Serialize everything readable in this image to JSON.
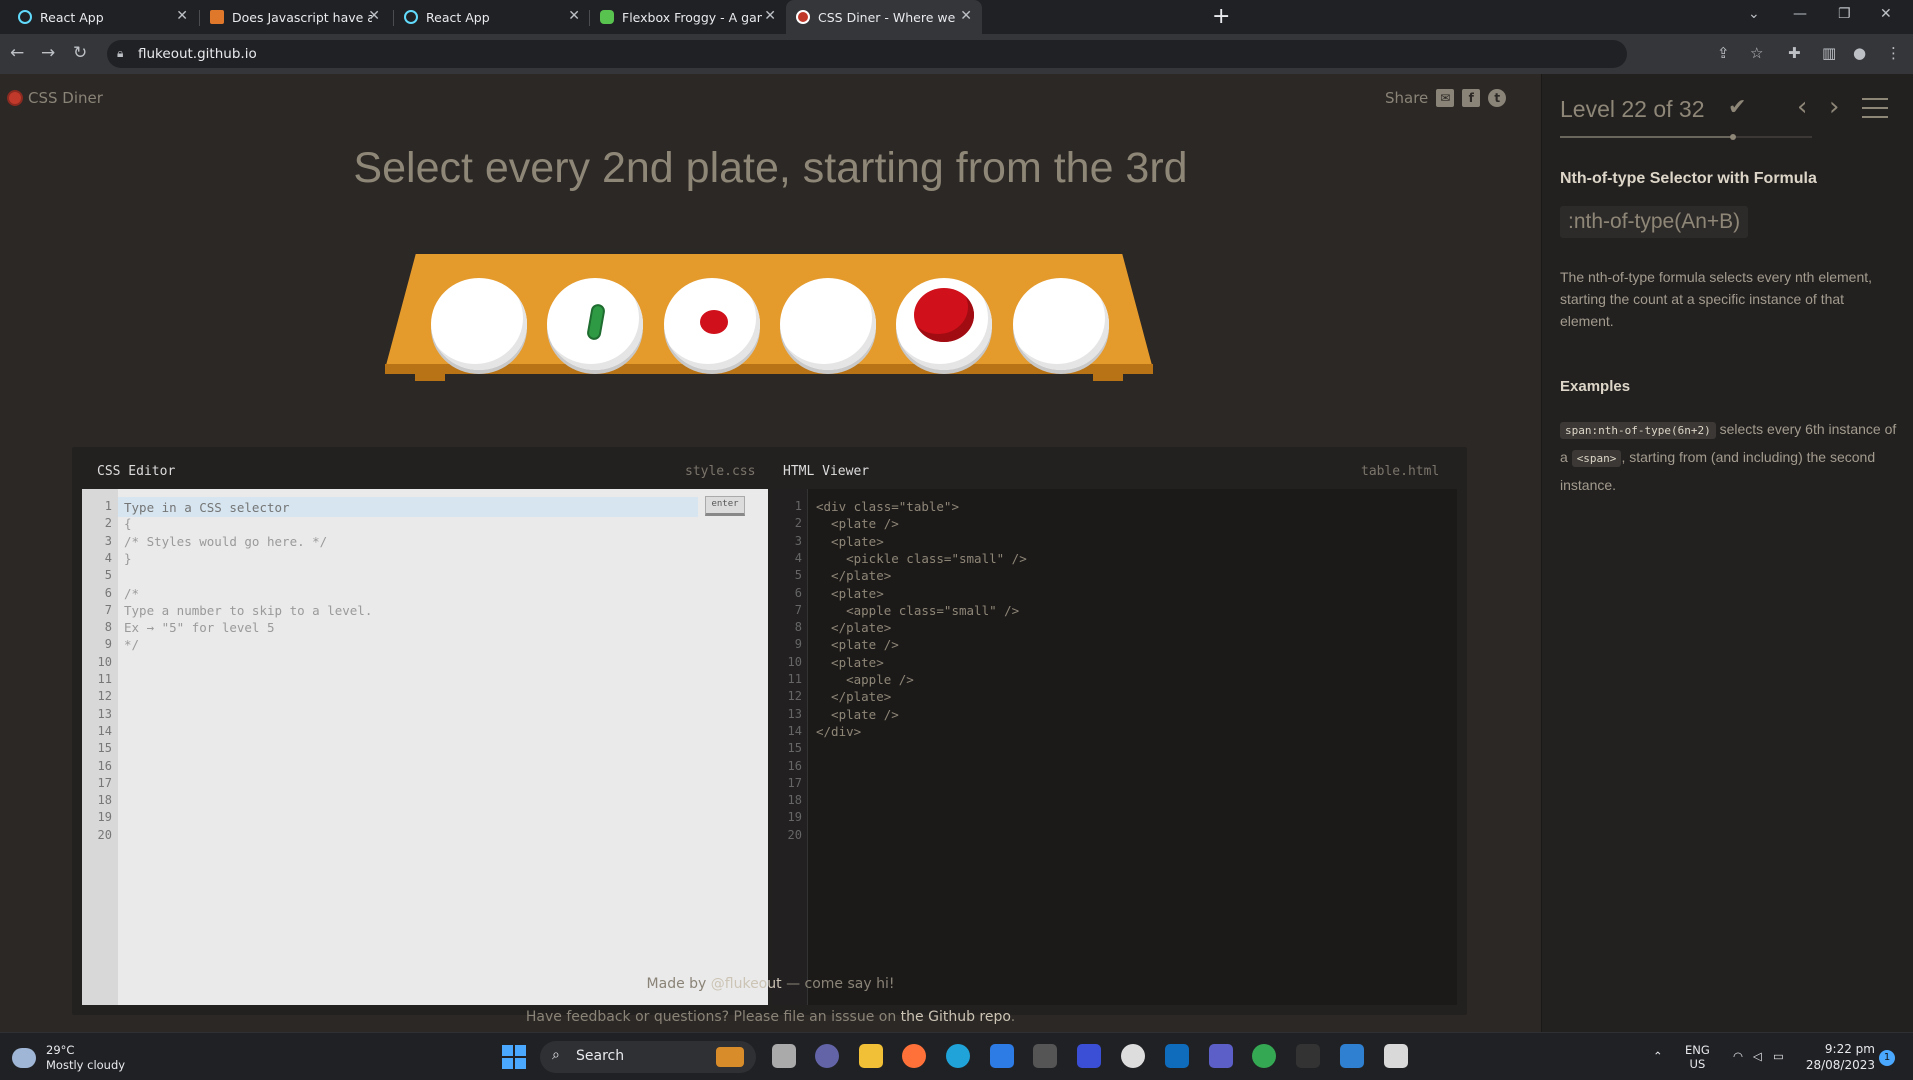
{
  "browser": {
    "tabs": [
      {
        "title": "React App"
      },
      {
        "title": "Does Javascript have an enhanced"
      },
      {
        "title": "React App"
      },
      {
        "title": "Flexbox Froggy - A game for learn"
      },
      {
        "title": "CSS Diner - Where we feast on CSS"
      }
    ],
    "url": "flukeout.github.io"
  },
  "app": {
    "logo_text": "CSS Diner",
    "share_label": "Share",
    "instruction": "Select every 2nd plate, starting from the 3rd"
  },
  "editor": {
    "css_title": "CSS Editor",
    "css_file": "style.css",
    "html_title": "HTML Viewer",
    "html_file": "table.html",
    "input_placeholder": "Type in a CSS selector",
    "enter_label": "enter",
    "css_lines": [
      "{",
      "/* Styles would go here. */",
      "}",
      "",
      "/*",
      "Type a number to skip to a level.",
      "Ex → \"5\" for level 5",
      "*/"
    ],
    "html_lines": [
      "<div class=\"table\">",
      "  <plate />",
      "  <plate>",
      "    <pickle class=\"small\" />",
      "  </plate>",
      "  <plate>",
      "    <apple class=\"small\" />",
      "  </plate>",
      "  <plate />",
      "  <plate>",
      "    <apple />",
      "  </plate>",
      "  <plate />",
      "</div>"
    ],
    "line_count": 20
  },
  "footer": {
    "made_by_prefix": "Made by",
    "author": "@flukeout",
    "made_by_suffix": "— come say hi!",
    "feedback_prefix": "Have feedback or questions? Please file an isssue on",
    "repo_link": "the Github repo",
    "feedback_suffix": "."
  },
  "sidebar": {
    "level_title": "Level 22 of 32",
    "level_current": 22,
    "level_total": 32,
    "selector_name": "Nth-of-type Selector with Formula",
    "syntax": ":nth-of-type(An+B)",
    "description": "The nth-of-type formula selects every nth element, starting the count at a specific instance of that element.",
    "examples_title": "Examples",
    "example_code": "span:nth-of-type(6n+2)",
    "example_text_1": "selects every 6th instance of a",
    "example_tag": "<span>",
    "example_text_2": ", starting from (and including) the second instance."
  },
  "taskbar": {
    "temperature": "29°C",
    "weather": "Mostly cloudy",
    "search_label": "Search",
    "language": "ENG",
    "region": "US",
    "time": "9:22 pm",
    "date": "28/08/2023",
    "notification_count": "1"
  },
  "colors": {
    "page_bg": "#2b2825",
    "table": "#e59a2c",
    "apple": "#d0101a",
    "pickle": "#2e9a44"
  }
}
